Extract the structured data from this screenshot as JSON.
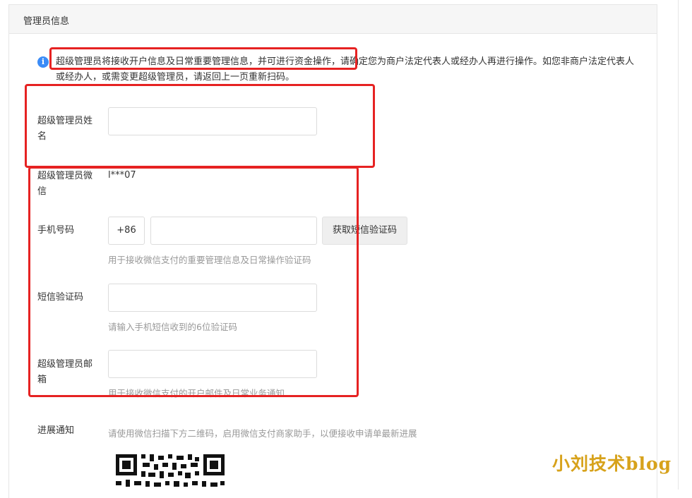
{
  "panel": {
    "title": "管理员信息"
  },
  "notice": {
    "highlight": "超级管理员将接收开户信息及日常重要管理信息，并可进行资金操作",
    "rest": "，请确定您为商户法定代表人或经办人再进行操作。如您非商户法定代表人或经办人，或需变更超级管理员，请返回上一页重新扫码。"
  },
  "fields": {
    "name": {
      "label_line1": "超级管理员姓",
      "label_line2": "名",
      "value": "",
      "placeholder": ""
    },
    "wechat": {
      "label_line1": "超级管理员微",
      "label_line2": "信",
      "value": "l***07"
    },
    "phone": {
      "label": "手机号码",
      "prefix": "+86",
      "value": "",
      "button": "获取短信验证码",
      "hint": "用于接收微信支付的重要管理信息及日常操作验证码"
    },
    "sms_code": {
      "label": "短信验证码",
      "value": "",
      "hint": "请输入手机短信收到的6位验证码"
    },
    "email": {
      "label_line1": "超级管理员邮",
      "label_line2": "箱",
      "value": "",
      "hint": "用于接收微信支付的开户邮件及日常业务通知"
    },
    "progress": {
      "label": "进展通知",
      "hint": "请使用微信扫描下方二维码，启用微信支付商家助手，以便接收申请单最新进展"
    }
  },
  "watermark": "小刘技术blog",
  "colors": {
    "info_icon": "#3b8cf7",
    "annotation_red": "#e62222",
    "watermark": "#d7a21b"
  }
}
